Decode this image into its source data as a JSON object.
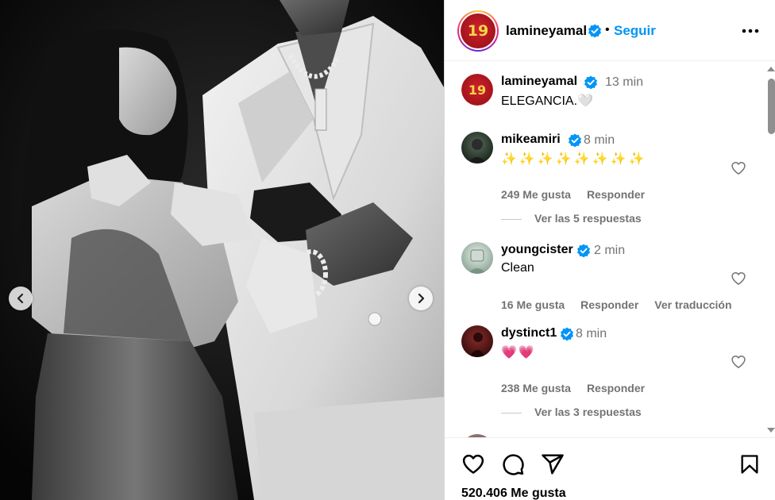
{
  "post": {
    "author": "lamineyamal",
    "avatar_number": "19",
    "follow_label": "Seguir",
    "dot": "•",
    "more_icon": "more-horizontal-icon",
    "likes_text": "520.406 Me gusta"
  },
  "caption": {
    "author": "lamineyamal",
    "time": "13 min",
    "text": "ELEGANCIA.🤍"
  },
  "comments": [
    {
      "author": "mikeamiri",
      "time": "8 min",
      "text": "✨✨✨✨✨✨✨✨",
      "likes": "249 Me gusta",
      "reply_label": "Responder",
      "replies_label": "Ver las 5 respuestas"
    },
    {
      "author": "youngcister",
      "time": "2 min",
      "text": "Clean",
      "likes": "16 Me gusta",
      "reply_label": "Responder",
      "translate_label": "Ver traducción"
    },
    {
      "author": "dystinct1",
      "time": "8 min",
      "text": "💗💗",
      "likes": "238 Me gusta",
      "reply_label": "Responder",
      "replies_label": "Ver las 3 respuestas"
    }
  ],
  "colors": {
    "link_blue": "#0095f6",
    "verified_blue": "#0095f6",
    "muted": "#737373",
    "jersey_red": "#c8102e",
    "jersey_gold": "#f4d64a"
  },
  "icons": {
    "like": "heart-icon",
    "comment": "comment-icon",
    "share": "share-icon",
    "save": "bookmark-icon",
    "carousel_prev": "chevron-left-icon",
    "carousel_next": "chevron-right-icon"
  }
}
